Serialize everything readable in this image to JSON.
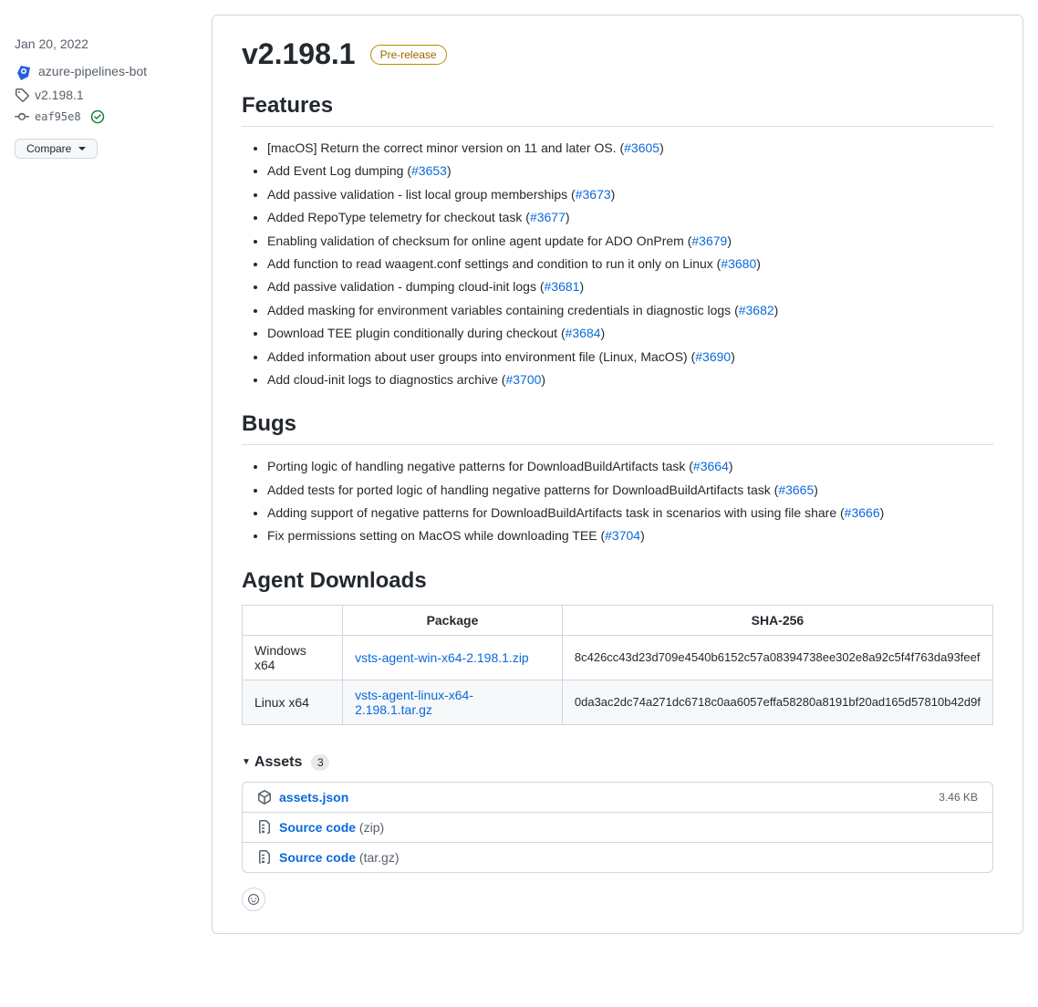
{
  "sidebar": {
    "date": "Jan 20, 2022",
    "author": "azure-pipelines-bot",
    "tag": "v2.198.1",
    "commit": "eaf95e8",
    "compare_label": "Compare"
  },
  "release": {
    "title": "v2.198.1",
    "badge": "Pre-release",
    "features_heading": "Features",
    "features": [
      {
        "text": "[macOS] Return the correct minor version on 11 and later OS. (",
        "link": "#3605",
        "suffix": ")"
      },
      {
        "text": "Add Event Log dumping (",
        "link": "#3653",
        "suffix": ")"
      },
      {
        "text": "Add passive validation - list local group memberships (",
        "link": "#3673",
        "suffix": ")"
      },
      {
        "text": "Added RepoType telemetry for checkout task (",
        "link": "#3677",
        "suffix": ")"
      },
      {
        "text": "Enabling validation of checksum for online agent update for ADO OnPrem (",
        "link": "#3679",
        "suffix": ")"
      },
      {
        "text": "Add function to read waagent.conf settings and condition to run it only on Linux (",
        "link": "#3680",
        "suffix": ")"
      },
      {
        "text": "Add passive validation - dumping cloud-init logs (",
        "link": "#3681",
        "suffix": ")"
      },
      {
        "text": "Added masking for environment variables containing credentials in diagnostic logs (",
        "link": "#3682",
        "suffix": ")"
      },
      {
        "text": "Download TEE plugin conditionally during checkout (",
        "link": "#3684",
        "suffix": ")"
      },
      {
        "text": "Added information about user groups into environment file (Linux, MacOS) (",
        "link": "#3690",
        "suffix": ")"
      },
      {
        "text": "Add cloud-init logs to diagnostics archive (",
        "link": "#3700",
        "suffix": ")"
      }
    ],
    "bugs_heading": "Bugs",
    "bugs": [
      {
        "text": "Porting logic of handling negative patterns for DownloadBuildArtifacts task (",
        "link": "#3664",
        "suffix": ")"
      },
      {
        "text": "Added tests for ported logic of handling negative patterns for DownloadBuildArtifacts task (",
        "link": "#3665",
        "suffix": ")"
      },
      {
        "text": "Adding support of negative patterns for DownloadBuildArtifacts task in scenarios with using file share (",
        "link": "#3666",
        "suffix": ")"
      },
      {
        "text": "Fix permissions setting on MacOS while downloading TEE (",
        "link": "#3704",
        "suffix": ")"
      }
    ],
    "downloads_heading": "Agent Downloads",
    "downloads": {
      "col_platform": "",
      "col_package": "Package",
      "col_sha": "SHA-256",
      "rows": [
        {
          "platform": "Windows x64",
          "package": "vsts-agent-win-x64-2.198.1.zip",
          "sha": "8c426cc43d23d709e4540b6152c57a08394738ee302e8a92c5f4f763da93feef"
        },
        {
          "platform": "Linux x64",
          "package": "vsts-agent-linux-x64-2.198.1.tar.gz",
          "sha": "0da3ac2dc74a271dc6718c0aa6057effa58280a8191bf20ad165d57810b42d9f"
        }
      ]
    },
    "assets_heading": "Assets",
    "assets_count": "3",
    "assets": [
      {
        "icon": "package",
        "name": "assets.json",
        "ext": "",
        "size": "3.46 KB"
      },
      {
        "icon": "zip",
        "name": "Source code",
        "ext": "(zip)",
        "size": ""
      },
      {
        "icon": "zip",
        "name": "Source code",
        "ext": "(tar.gz)",
        "size": ""
      }
    ]
  }
}
